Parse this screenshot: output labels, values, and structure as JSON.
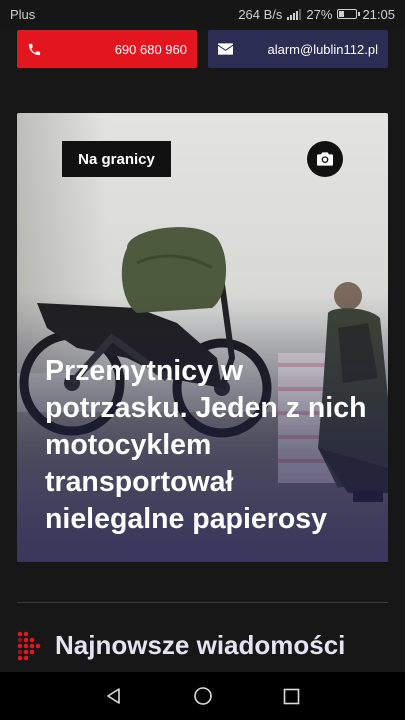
{
  "status_bar": {
    "carrier": "Plus",
    "speed": "264 B/s",
    "battery": "27%",
    "battery_level": 0.27,
    "time": "21:05"
  },
  "contacts": {
    "phone": "690 680 960",
    "email": "alarm@lublin112.pl",
    "phone_color": "#e3151f",
    "email_color": "#2b2e52"
  },
  "article": {
    "category": "Na granicy",
    "title": "Przemytnicy w potrzasku. Jeden z nich motocyklem transportował nielegalne papierosy",
    "icons": [
      "camera-icon"
    ]
  },
  "section": {
    "title": "Najnowsze wiadomości",
    "icon": "arrow-dots-icon",
    "accent": "#e3151f"
  },
  "nav": {
    "icons": [
      "back-icon",
      "home-icon",
      "recents-icon"
    ]
  }
}
